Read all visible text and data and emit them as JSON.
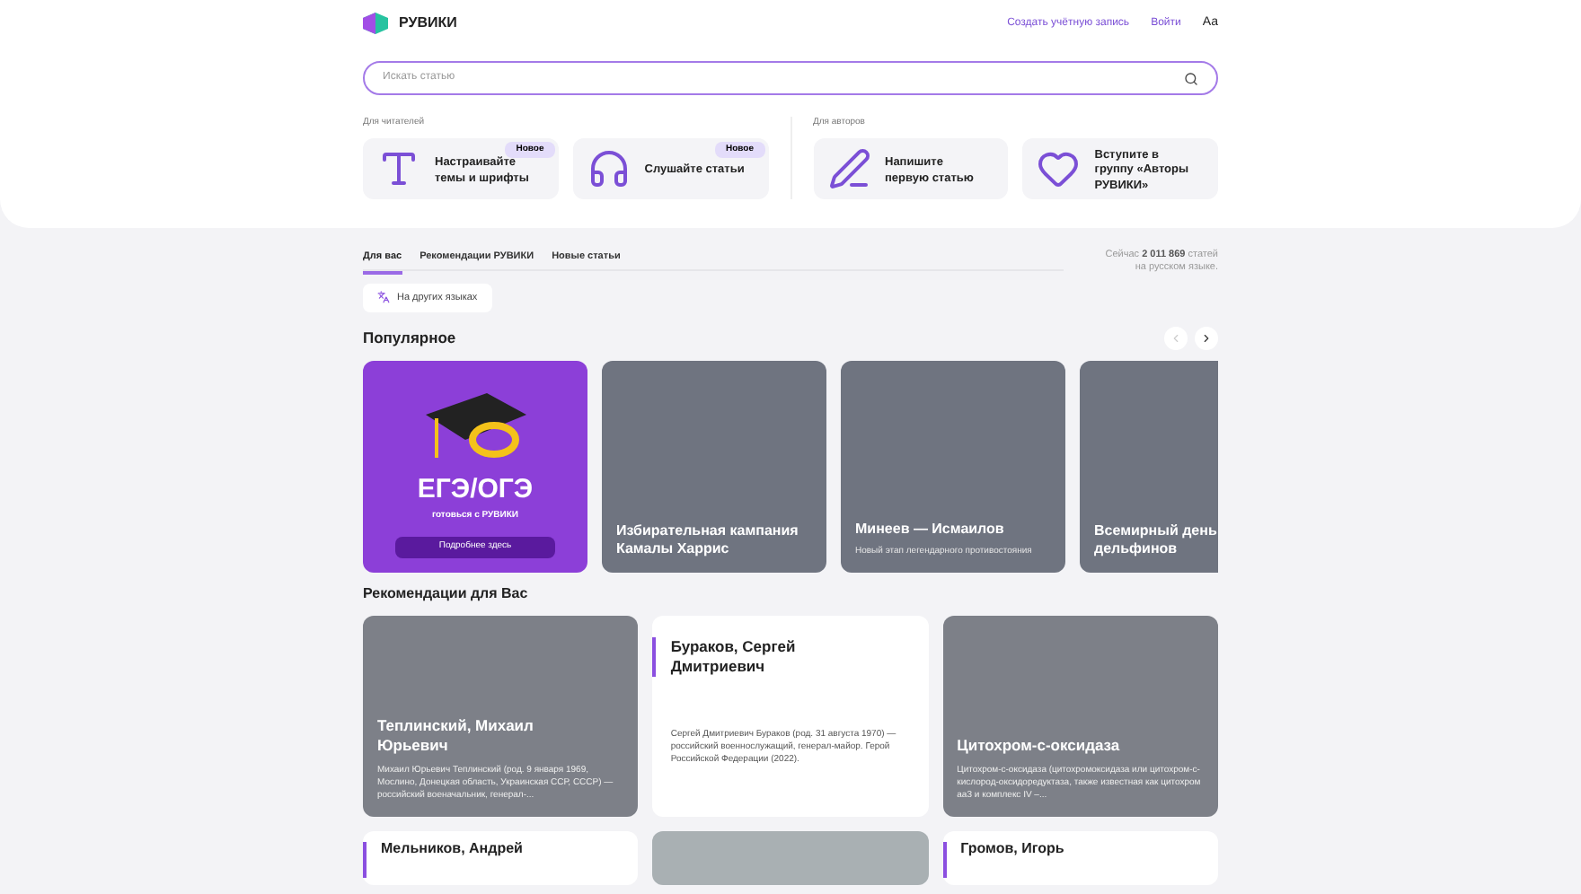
{
  "header": {
    "logo": "РУВИКИ",
    "links": [
      "Создать учётную запись",
      "Войти"
    ],
    "text_size": "Аа"
  },
  "search": {
    "placeholder": "Искать статью"
  },
  "promo_groups": [
    {
      "label": "Для читателей",
      "items": [
        {
          "kind": "font",
          "title": "Настраивайте темы и шрифты",
          "badge": "Новое"
        },
        {
          "kind": "headphones",
          "title": "Слушайте статьи",
          "badge": "Новое"
        }
      ]
    },
    {
      "label": "Для авторов",
      "items": [
        {
          "kind": "pen",
          "title": "Напишите первую статью"
        },
        {
          "kind": "heart",
          "title": "Вступите в группу «Авторы РУВИКИ»"
        }
      ]
    }
  ],
  "tabs": [
    {
      "label": "Для вас",
      "selected": true
    },
    {
      "label": "Рекомендации РУВИКИ",
      "selected": false
    },
    {
      "label": "Новые статьи",
      "selected": false
    }
  ],
  "article_count": {
    "before": "Сейчас ",
    "count": "2 011 869",
    "after": " статей на русском языке."
  },
  "other_languages": "На других языках",
  "popular": {
    "title": "Популярное",
    "cards": [
      {
        "kind": "promo",
        "title": "ЕГЭ/ОГЭ",
        "subtitle": "готовься с РУВИКИ",
        "button": "Подробнее здесь"
      },
      {
        "kind": "photo",
        "title": "Избирательная кампания Камалы Харрис"
      },
      {
        "kind": "photo",
        "title": "Минеев — Исмаилов",
        "subtitle": "Новый этап легендарного противостояния"
      },
      {
        "kind": "photo",
        "title": "Всемирный день дельфинов"
      }
    ]
  },
  "recommendations": {
    "title": "Рекомендации для Вас",
    "cards": [
      {
        "kind": "photo",
        "title": "Теплинский, Михаил Юрьевич",
        "text": "Михаил Юрьевич Теплинский (род. 9 января 1969, Мослино, Донецкая область, Украинская ССР, СССР) — российский военачальник, генерал-..."
      },
      {
        "kind": "text",
        "title": "Бураков, Сергей Дмитриевич",
        "text": "Сергей Дмитриевич Бураков (род. 31 августа 1970) — российский военнослужащий, генерал-майор. Герой Российской Федерации (2022)."
      },
      {
        "kind": "photo",
        "title": "Цитохром-c-оксидаза",
        "text": "Цитохром-c-оксидаза (цитохромоксидаза или цитохром-c-кислород-оксидоредуктаза, также известная как цитохром aa3 и комплекс IV –..."
      },
      {
        "kind": "text",
        "title": "Мельников, Андрей"
      },
      {
        "kind": "photo"
      },
      {
        "kind": "text",
        "title": "Громов, Игорь"
      }
    ]
  }
}
